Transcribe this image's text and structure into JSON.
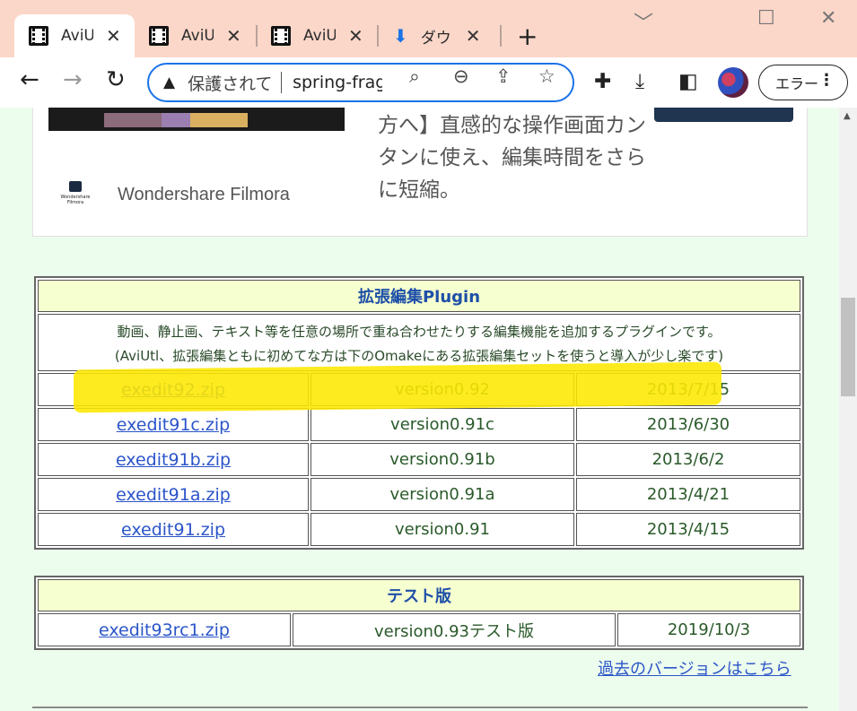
{
  "tabs": [
    {
      "title": "AviUtl",
      "close": "✕",
      "icon": "film-icon"
    },
    {
      "title": "AviUtl",
      "close": "✕",
      "icon": "film-icon"
    },
    {
      "title": "AviUtl",
      "close": "✕",
      "icon": "film-icon"
    },
    {
      "title": "ダウンロード",
      "close": "✕",
      "icon": "download-icon"
    }
  ],
  "new_tab": "+",
  "window_controls": {
    "minimize": "﹀",
    "restore": "☐",
    "close": "✕"
  },
  "toolbar": {
    "security_label": "保護されていない通信",
    "url": "spring-fragrance.mints.ne.jp",
    "error_button": "エラー"
  },
  "ad": {
    "text": "方へ】直感的な操作画面カンタンに使え、編集時間をさらに短縮。",
    "brand": "Wondershare Filmora",
    "logo_text": "Wondershare Filmora"
  },
  "plugin_table": {
    "title": "拡張編集Plugin",
    "description_line1": "動画、静止画、テキスト等を任意の場所で重ね合わせたりする編集機能を追加するプラグインです。",
    "description_line2": "(AviUtl、拡張編集ともに初めてな方は下のOmakeにある拡張編集セットを使うと導入が少し楽です)",
    "rows": [
      {
        "file": "exedit92.zip",
        "version": "version0.92",
        "date": "2013/7/15"
      },
      {
        "file": "exedit91c.zip",
        "version": "version0.91c",
        "date": "2013/6/30"
      },
      {
        "file": "exedit91b.zip",
        "version": "version0.91b",
        "date": "2013/6/2"
      },
      {
        "file": "exedit91a.zip",
        "version": "version0.91a",
        "date": "2013/4/21"
      },
      {
        "file": "exedit91.zip",
        "version": "version0.91",
        "date": "2013/4/15"
      }
    ]
  },
  "test_table": {
    "title": "テスト版",
    "rows": [
      {
        "file": "exedit93rc1.zip",
        "version": "version0.93テスト版",
        "date": "2019/10/3"
      }
    ]
  },
  "past_versions_link": "過去のバージョンはこちら",
  "colors": {
    "tabstrip": "#fbd7c9",
    "accent": "#1a73e8",
    "page_bg": "#ecfced",
    "table_header": "#f6ffcf",
    "highlight": "#fde800",
    "link": "#2b55c9"
  }
}
